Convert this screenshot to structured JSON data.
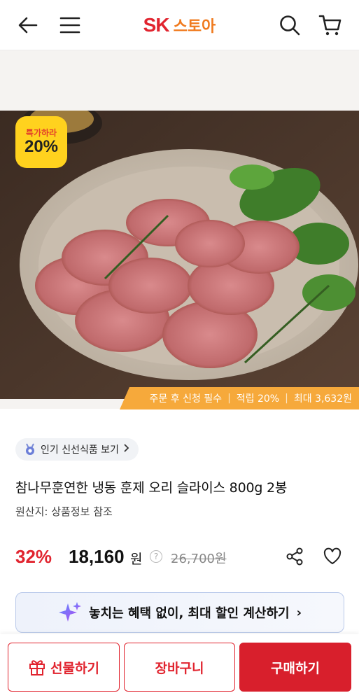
{
  "header": {
    "logo_sk": "SK",
    "logo_store": "스토아",
    "icons": [
      "back-arrow-icon",
      "menu-icon",
      "search-icon",
      "cart-icon"
    ]
  },
  "badge": {
    "line1": "특가하라",
    "line2": "20%"
  },
  "benefit_strip": {
    "item1": "주문 후 신청 필수",
    "item2": "적립 20%",
    "item3": "최대 3,632원"
  },
  "product": {
    "tag": "인기 신선식품 보기",
    "title": "참나무훈연한 냉동 훈제 오리 슬라이스 800g 2봉",
    "origin": "원산지: 상품정보 참조",
    "discount": "32%",
    "price": "18,160",
    "currency": "원",
    "original_price": "26,700원"
  },
  "calc_banner": {
    "text": "놓치는 혜택 없이, 최대 할인 계산하기",
    "chevron": "›"
  },
  "bottom_bar": {
    "gift_label": "선물하기",
    "cart_label": "장바구니",
    "buy_label": "구매하기"
  },
  "colors": {
    "brand_red": "#e1242f",
    "brand_orange": "#f07a1e",
    "strip_orange": "#f6a93b",
    "badge_yellow": "#ffd21e"
  }
}
